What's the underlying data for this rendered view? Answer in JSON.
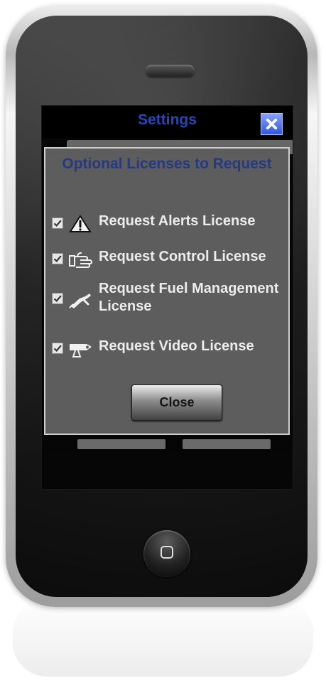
{
  "app": {
    "title": "Settings"
  },
  "modal": {
    "title": "Optional Licenses to Request",
    "options": [
      {
        "label": "Request Alerts License",
        "checked": true,
        "icon": "warning-icon"
      },
      {
        "label": "Request Control License",
        "checked": true,
        "icon": "hand-pointer-icon"
      },
      {
        "label": "Request Fuel Management License",
        "checked": true,
        "icon": "fuel-nozzle-icon"
      },
      {
        "label": "Request Video License",
        "checked": true,
        "icon": "video-camera-icon"
      }
    ],
    "close_button_label": "Close"
  },
  "colors": {
    "title_blue": "#2a45b8",
    "modal_gray": "#5d5d5d",
    "close_icon_blue": "#2e55db"
  }
}
